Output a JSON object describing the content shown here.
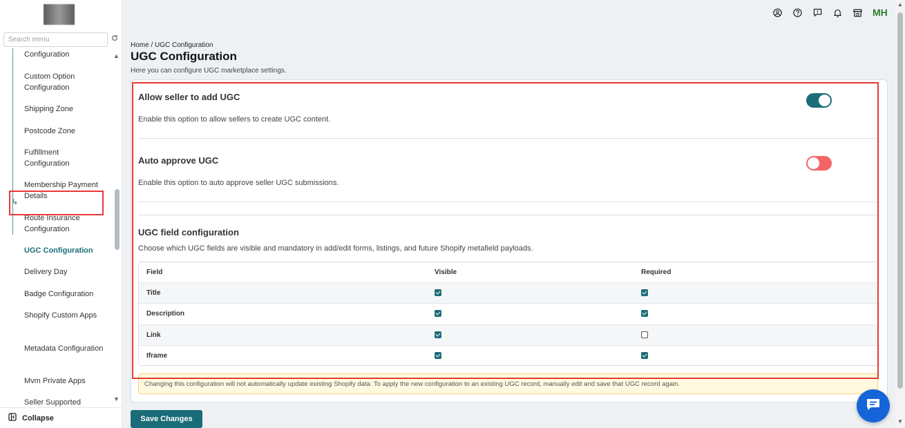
{
  "sidebar": {
    "search_placeholder": "Search menu",
    "items": [
      {
        "label": "Configuration"
      },
      {
        "label": "Custom Option Configuration"
      },
      {
        "label": "Shipping Zone"
      },
      {
        "label": "Postcode Zone"
      },
      {
        "label": "Fulfillment Configuration"
      },
      {
        "label": "Membership Payment Details"
      },
      {
        "label": "Route Insurance Configuration"
      },
      {
        "label": "UGC Configuration"
      },
      {
        "label": "Delivery Day"
      },
      {
        "label": "Badge Configuration"
      },
      {
        "label": "Shopify Custom Apps"
      },
      {
        "label": "Metadata Configuration"
      },
      {
        "label": "Mvm Private Apps"
      },
      {
        "label": "Seller Supported"
      }
    ],
    "active_item": "UGC Configuration",
    "collapse_label": "Collapse"
  },
  "header": {
    "icons": [
      "account-circle-icon",
      "help-icon",
      "feedback-icon",
      "bell-icon",
      "store-icon"
    ],
    "avatar_initials": "MH"
  },
  "page": {
    "breadcrumb": "Home / UGC Configuration",
    "title": "UGC Configuration",
    "subtitle": "Here you can configure UGC marketplace settings."
  },
  "settings": {
    "allow_seller": {
      "title": "Allow seller to add UGC",
      "description": "Enable this option to allow sellers to create UGC content.",
      "enabled": true
    },
    "auto_approve": {
      "title": "Auto approve UGC",
      "description": "Enable this option to auto approve seller UGC submissions.",
      "enabled": false
    },
    "field_config": {
      "title": "UGC field configuration",
      "description": "Choose which UGC fields are visible and mandatory in add/edit forms, listings, and future Shopify metafield payloads.",
      "columns": [
        "Field",
        "Visible",
        "Required"
      ],
      "rows": [
        {
          "field": "Title",
          "visible": true,
          "required": true
        },
        {
          "field": "Description",
          "visible": true,
          "required": true
        },
        {
          "field": "Link",
          "visible": true,
          "required": false
        },
        {
          "field": "Iframe",
          "visible": true,
          "required": true
        }
      ]
    },
    "note": "Changing this configuration will not automatically update existing Shopify data. To apply the new configuration to an existing UGC record, manually edit and save that UGC record again."
  },
  "actions": {
    "save_label": "Save Changes"
  },
  "colors": {
    "accent": "#1a6d78",
    "toggle_off": "#f26566",
    "highlight": "#e53935",
    "chat": "#1565d8"
  }
}
